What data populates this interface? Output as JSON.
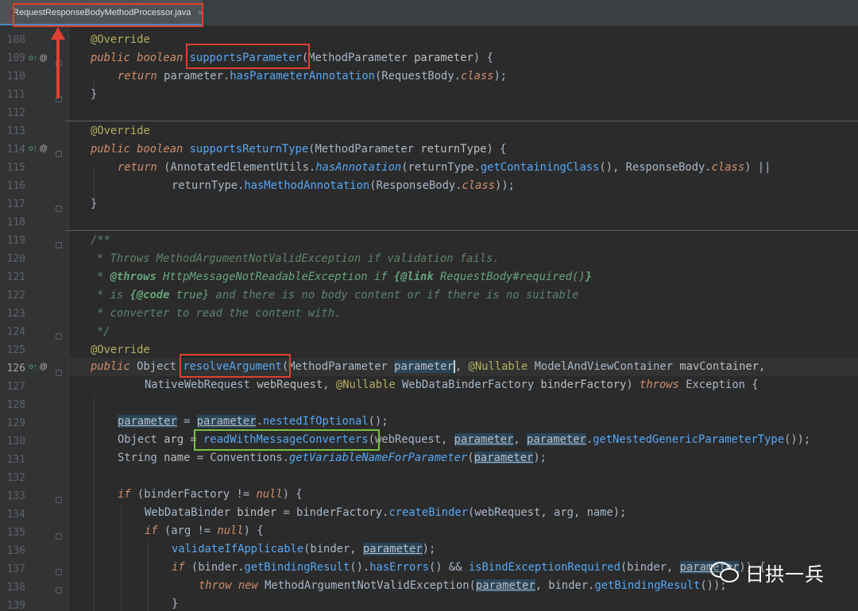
{
  "tab": {
    "file_name": "RequestResponseBodyMethodProcessor.java",
    "close_glyph": "×"
  },
  "gutter": {
    "line_numbers": [
      "108",
      "109",
      "110",
      "111",
      "112",
      "113",
      "114",
      "115",
      "116",
      "117",
      "118",
      "119",
      "120",
      "121",
      "122",
      "123",
      "124",
      "125",
      "126",
      "127",
      "128",
      "129",
      "130",
      "131",
      "132",
      "133",
      "134",
      "135",
      "136",
      "137",
      "138",
      "139"
    ],
    "markers": [
      "o↑",
      "@"
    ]
  },
  "code": {
    "l108": [
      "@Override"
    ],
    "l109": [
      "public",
      "boolean",
      "supportsParameter",
      "(MethodParameter ",
      "parameter",
      ") {"
    ],
    "l110": [
      "return",
      " parameter.",
      "hasParameterAnnotation",
      "(RequestBody.",
      "class",
      ");"
    ],
    "l111": [
      "}"
    ],
    "l113": [
      "@Override"
    ],
    "l114": [
      "public",
      "boolean",
      "supportsReturnType",
      "(MethodParameter ",
      "returnType",
      ") {"
    ],
    "l115": [
      "return",
      " (AnnotatedElementUtils.",
      "hasAnnotation",
      "(returnType.",
      "getContainingClass",
      "(), ResponseBody.",
      "class",
      ") ||"
    ],
    "l116": [
      "returnType.",
      "hasMethodAnnotation",
      "(ResponseBody.",
      "class",
      "));"
    ],
    "l117": [
      "}"
    ],
    "l119": [
      "/**"
    ],
    "l120": [
      "* Throws MethodArgumentNotValidException if validation fails."
    ],
    "l121": [
      "* ",
      "@throws",
      " HttpMessageNotReadableException if ",
      "{@link",
      " RequestBody#required()",
      "}"
    ],
    "l122": [
      "* is ",
      "{@code",
      " true}",
      " and there is no body content or if there is no suitable"
    ],
    "l123": [
      "* converter to read the content with."
    ],
    "l124": [
      "*/"
    ],
    "l125": [
      "@Override"
    ],
    "l126": [
      "public",
      "Object",
      "resolveArgument",
      "(MethodParameter ",
      "parameter",
      ", ",
      "@Nullable",
      " ModelAndViewContainer ",
      "mavContainer",
      ","
    ],
    "l127": [
      "NativeWebRequest ",
      "webRequest",
      ", ",
      "@Nullable",
      " WebDataBinderFactory ",
      "binderFactory",
      ") ",
      "throws",
      " Exception {"
    ],
    "l129": [
      "parameter",
      " = ",
      "parameter",
      ".",
      "nestedIfOptional",
      "();"
    ],
    "l130": [
      "Object ",
      "arg",
      " = ",
      "readWithMessageConverters",
      "(webRequest, ",
      "parameter",
      ", ",
      "parameter",
      ".",
      "getNestedGenericParameterType",
      "());"
    ],
    "l131": [
      "String ",
      "name",
      " = Conventions.",
      "getVariableNameForParameter",
      "(",
      "parameter",
      ");"
    ],
    "l133": [
      "if",
      " (binderFactory != ",
      "null",
      ") {"
    ],
    "l134": [
      "WebDataBinder ",
      "binder",
      " = binderFactory.",
      "createBinder",
      "(webRequest, arg, name);"
    ],
    "l135": [
      "if",
      " (arg != ",
      "null",
      ") {"
    ],
    "l136": [
      "validateIfApplicable",
      "(binder, ",
      "parameter",
      ");"
    ],
    "l137": [
      "if",
      " (binder.",
      "getBindingResult",
      "().",
      "hasErrors",
      "() && ",
      "isBindExceptionRequired",
      "(binder, ",
      "parameter",
      ")) {"
    ],
    "l138": [
      "throw",
      " ",
      "new",
      " MethodArgumentNotValidException(",
      "parameter",
      ", binder.",
      "getBindingResult",
      "());"
    ],
    "l139": [
      "}"
    ]
  },
  "watermark": {
    "text": "日拱一兵"
  },
  "colors": {
    "highlight_red": "#e04030",
    "highlight_green": "#7ac142",
    "editor_bg": "#2b2b2b"
  }
}
